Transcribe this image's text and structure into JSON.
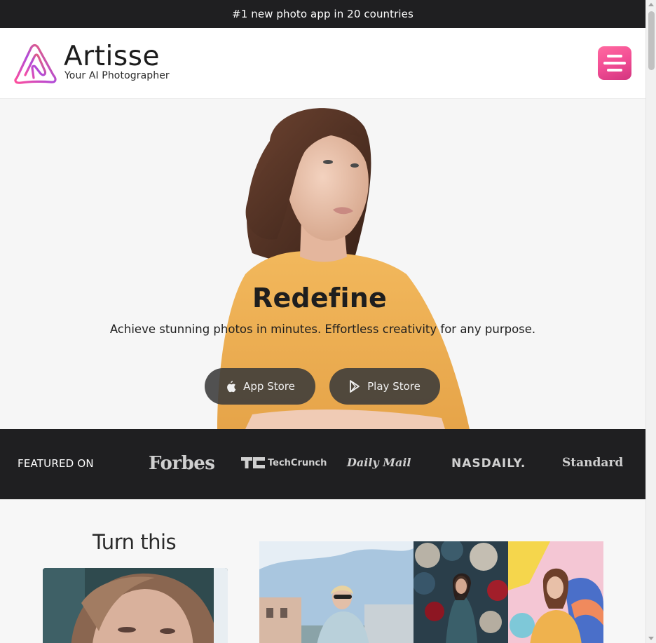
{
  "banner": {
    "text": "#1 new photo app in 20 countries"
  },
  "header": {
    "brand_name": "Artisse",
    "brand_tagline": "Your AI Photographer",
    "logo_icon": "artisse-logo-icon",
    "menu_icon": "hamburger-menu-icon",
    "accent_color": "#f24d94"
  },
  "hero": {
    "title": "Redefine",
    "subtitle": "Achieve stunning photos in minutes. Effortless creativity for any purpose.",
    "buttons": [
      {
        "label": "App Store",
        "icon": "apple-icon"
      },
      {
        "label": "Play Store",
        "icon": "play-store-icon"
      }
    ]
  },
  "featured": {
    "label": "FEATURED ON",
    "outlets": [
      "Forbes",
      "TechCrunch",
      "Daily Mail",
      "NASDAILY.",
      "Standard"
    ]
  },
  "showcase": {
    "title": "Turn this"
  }
}
